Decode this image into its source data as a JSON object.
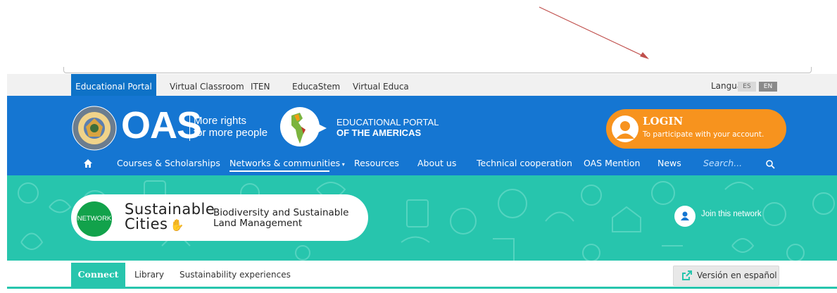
{
  "top_tabs": [
    "Educational Portal",
    "Virtual Classroom",
    "ITEN",
    "EducaStem",
    "Virtual Educa"
  ],
  "language": {
    "label": "Language",
    "options": [
      "ES",
      "EN"
    ]
  },
  "header": {
    "brand": "OAS",
    "slogan_line1": "More rights",
    "slogan_line2": "for more people",
    "portal_line1": "EDUCATIONAL PORTAL",
    "portal_line2": "OF THE AMERICAS"
  },
  "login": {
    "title": "LOGIN",
    "subtitle": "To participate with your account."
  },
  "nav": {
    "items": [
      "Courses & Scholarships",
      "Networks & communities",
      "Resources",
      "About us",
      "Technical cooperation",
      "OAS Mention",
      "News"
    ],
    "search_placeholder": "Search..."
  },
  "banner": {
    "network_badge": "NETWORK",
    "title_line1": "Sustainable",
    "title_line2": "Cities",
    "subtitle": "Biodiversity and Sustainable Land Management",
    "join": "Join this network"
  },
  "subtabs": [
    "Connect",
    "Library",
    "Sustainability experiences"
  ],
  "version_button": "Versión en español",
  "colors": {
    "blue": "#1576d2",
    "orange": "#f7931e",
    "teal": "#27c5ad",
    "green": "#12a24b"
  }
}
